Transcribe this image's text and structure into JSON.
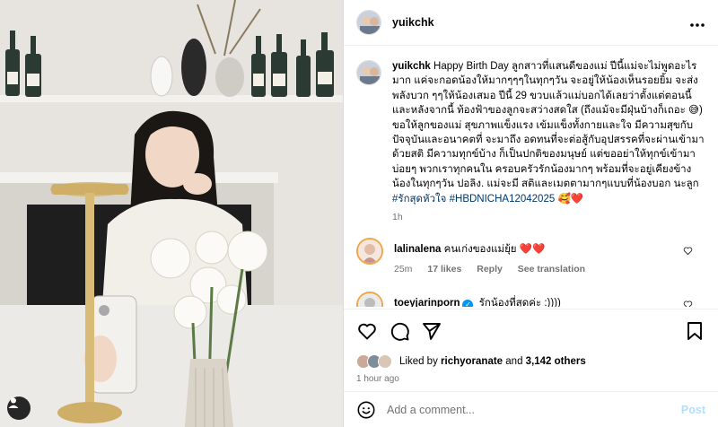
{
  "post": {
    "author": "yuikchk",
    "caption_body": "Happy Birth Day ลูกสาวที่แสนดีของแม่ ปีนี้แม่จะไม่พูดอะไรมาก แค่จะกอดน้องให้มากๆๆๆในทุกๆวัน จะอยู่ให้น้องเห็นรอยยิ้ม จะส่งพลังบวก ๆๆให้น้องเสมอ ปีนี้ 29 ขวบแล้วแม่บอกได้เลยว่าตั้งแต่ตอนนี้และหลังจากนี้ ท้องฟ้าของลูกจะสว่างสดใส (ถึงแม้จะมีฝุ่นบ้างก็เถอะ 😅) ขอให้ลูกของแม่ สุขภาพแข็งแรง เข้มแข็งทั้งกายและใจ มีความสุขกับปัจจุบันและอนาคตที่ จะมาถึง อดทนที่จะต่อสู้กับอุปสรรคที่จะผ่านเข้ามาด้วยสติ มีความทุกข์บ้าง ก็เป็นปกติของมนุษย์ แต่ขออย่าให้ทุกข์เข้ามาบ่อยๆ พวกเราทุกคนใน ครอบครัวรักน้องมากๆ พร้อมที่จะอยู่เคียงข้างน้องในทุกๆวัน ปอลิง. แม่จะมี สติและเมตตามากๆแบบที่น้องบอก นะลูก",
    "hashtag_1": "#รักสุดหัวใจ",
    "hashtag_2": "#HBDNICHA12042025",
    "caption_emojis": "🥰❤️",
    "caption_time": "1h"
  },
  "comments": [
    {
      "username": "lalinalena",
      "text": "คนเก่งของแม่ยุ้ย",
      "emoji": "❤️❤️",
      "time": "25m",
      "likes": "17 likes",
      "reply": "Reply",
      "translation": "See translation"
    },
    {
      "username": "toeyjarinporn",
      "verified_mark": "✓",
      "text": "รักน้องที่สุดค่ะ :))))",
      "time": "",
      "likes": "",
      "reply": "",
      "translation": ""
    }
  ],
  "likes_bar": {
    "prefix": "Liked by",
    "user": "richyoranate",
    "connector": "and",
    "others": "3,142 others",
    "time": "1 hour ago"
  },
  "composer": {
    "placeholder": "Add a comment...",
    "post_label": "Post"
  },
  "icons": {
    "more": "more-horizontal-icon",
    "like": "heart-icon",
    "comment": "comment-icon",
    "share": "paper-plane-icon",
    "save": "bookmark-icon",
    "emoji": "emoji-icon",
    "user_tag": "person-icon"
  },
  "colors": {
    "link_blue": "#00376b",
    "verified_blue": "#0095f6",
    "heart_red": "#ed4956",
    "post_disabled": "#b2dffc"
  }
}
